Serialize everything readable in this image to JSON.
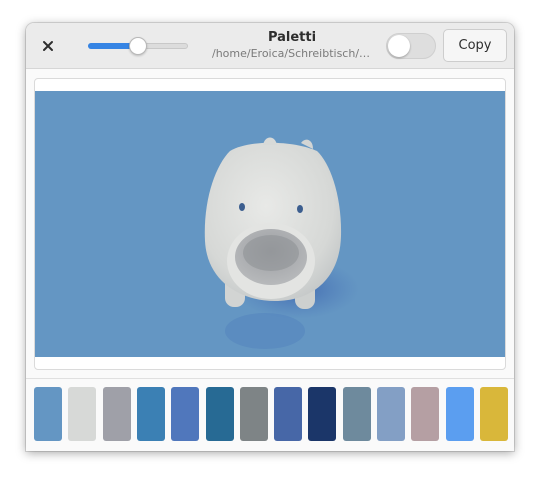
{
  "header": {
    "title": "Paletti",
    "subtitle": "/home/Eroica/Schreibtisch/pig.png",
    "copy_label": "Copy",
    "close_icon": "close-icon",
    "slider_value_percent": 50,
    "toggle_on": false
  },
  "palette": {
    "colors": [
      "#6496c3",
      "#d7d9d7",
      "#9fa0a8",
      "#3b80b4",
      "#5077bc",
      "#276a94",
      "#7e8486",
      "#4767a7",
      "#1b3669",
      "#6e8a9d",
      "#839fc5",
      "#b59fa3",
      "#5b9ef0",
      "#d9b73a"
    ]
  },
  "image": {
    "background_color": "#6496c3",
    "subject": "pig-shaped object"
  }
}
